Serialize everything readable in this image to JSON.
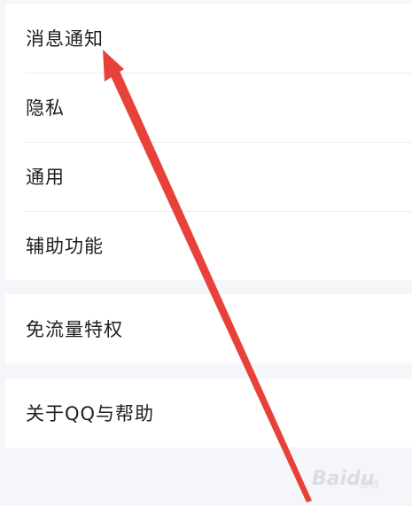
{
  "settings": {
    "group1": [
      {
        "label": "消息通知"
      },
      {
        "label": "隐私"
      },
      {
        "label": "通用"
      },
      {
        "label": "辅助功能"
      }
    ],
    "group2": [
      {
        "label": "免流量特权"
      }
    ],
    "group3": [
      {
        "label": "关于QQ与帮助"
      }
    ]
  },
  "annotation": {
    "arrow_color": "#e8413a",
    "target": "消息通知"
  },
  "watermark": {
    "brand": "Baidu",
    "sub": "经验"
  },
  "colors": {
    "background": "#f5f6fa",
    "card": "#ffffff",
    "text": "#1f1f1f",
    "divider": "#ececec"
  }
}
